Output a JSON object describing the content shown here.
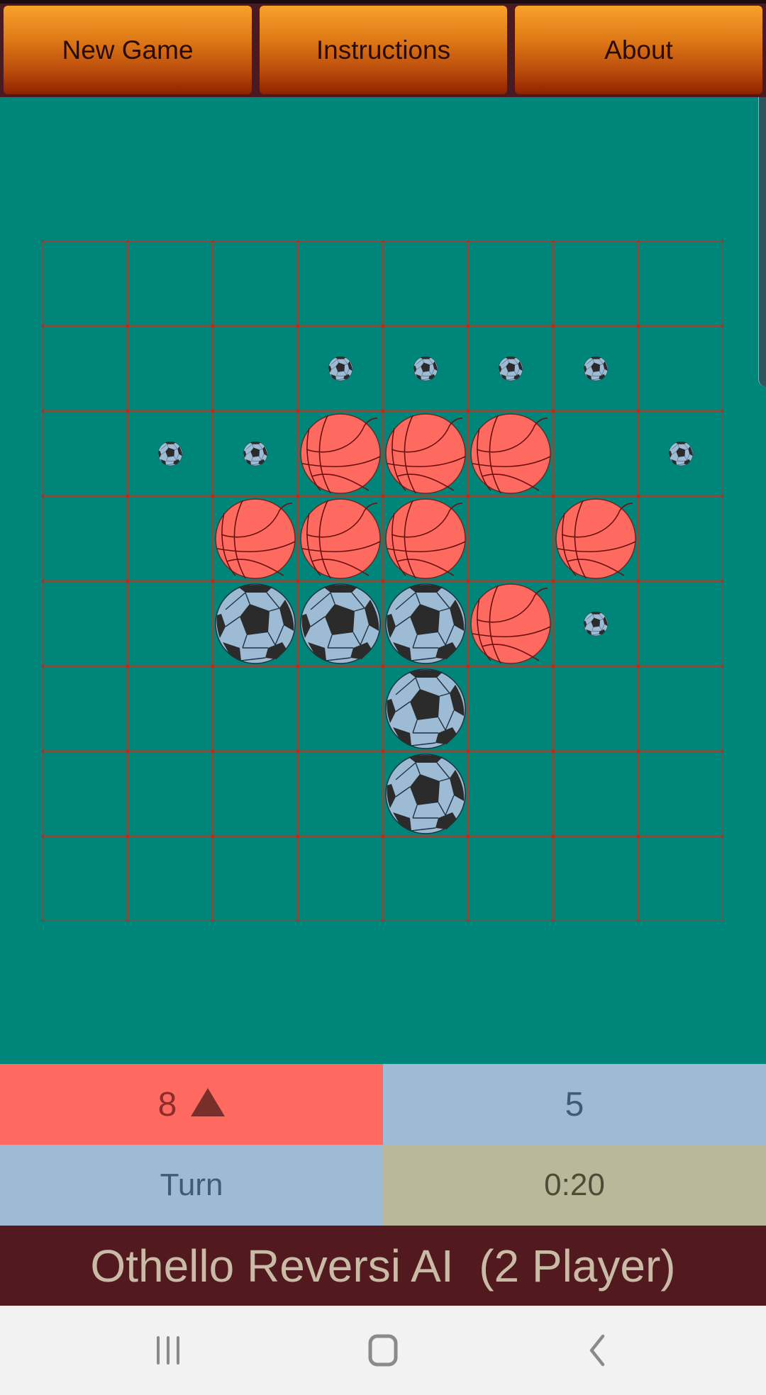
{
  "toolbar": {
    "buttons": [
      {
        "label": "New Game"
      },
      {
        "label": "Instructions"
      },
      {
        "label": "About"
      }
    ]
  },
  "board": {
    "size": 8,
    "legend": {
      "B": "basketball-piece",
      "S": "soccer-piece",
      "h": "soccer-move-hint"
    },
    "rows": [
      "........",
      "...hhhh.",
      ".hhBBB.h",
      "..BBB.B.",
      "..SSSBh.",
      "....S...",
      "....S...",
      "........"
    ]
  },
  "score": {
    "basketball_count": "8",
    "soccer_count": "5",
    "turn_indicator": "up-triangle",
    "turn_label": "Turn",
    "timer": "0:20"
  },
  "title": "Othello Reversi AI  (2 Player)",
  "colors": {
    "board_bg": "#00857a",
    "grid_line": "#8b4a3a",
    "basketball": "#ff6a60",
    "soccer_light": "#9ebbd6",
    "soccer_dark": "#2b2b2b",
    "title_bg": "#52191f"
  },
  "navbar": {
    "icons": [
      "recents-icon",
      "home-icon",
      "back-icon"
    ]
  }
}
